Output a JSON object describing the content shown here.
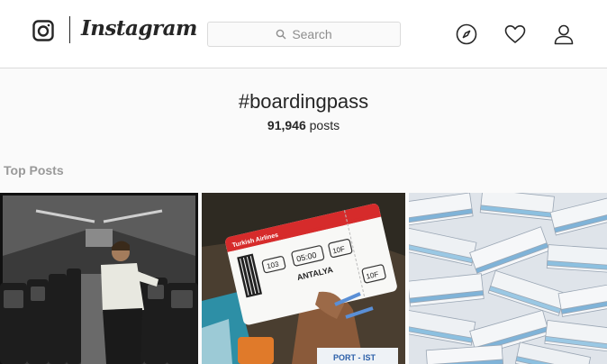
{
  "header": {
    "brand": "Instagram",
    "search_placeholder": "Search",
    "nav_icons": [
      "compass-icon",
      "heart-icon",
      "user-icon"
    ]
  },
  "tag": {
    "title": "#boardingpass",
    "post_count": "91,946",
    "post_count_suffix": " posts"
  },
  "top_posts": {
    "label": "Top Posts",
    "posts": [
      {
        "ticket_text": []
      },
      {
        "ticket_text": [
          "Turkish Airlines",
          "103",
          "05:00",
          "10F",
          "ANTALYA",
          "10F",
          "PORT - IST"
        ]
      },
      {
        "ticket_text": []
      }
    ]
  },
  "colors": {
    "border": "#dbdbdb",
    "text": "#262626",
    "muted": "#8e8e8e",
    "ticket_red": "#d62b2b",
    "ticket_blue": "#5a8fd6"
  }
}
